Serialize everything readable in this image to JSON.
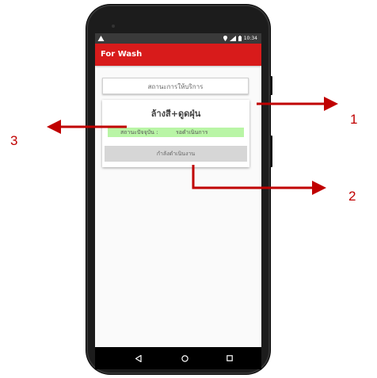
{
  "statusbar": {
    "time": "10:34",
    "icons": [
      "warning-icon",
      "location-icon",
      "signal-icon",
      "battery-icon"
    ]
  },
  "appbar": {
    "title": "For Wash"
  },
  "service_button": {
    "label": "สถานะการให้บริการ"
  },
  "card": {
    "title": "ล้างสี+ดูดฝุ่น",
    "status_label": "สถานะปัจจุบัน :",
    "status_value": "รอดำเนินการ",
    "progress_button": "กำลังดำเนินงาน"
  },
  "navbar": {
    "icons": [
      "back-icon",
      "home-icon",
      "recents-icon"
    ]
  },
  "annotations": {
    "labels": [
      "1",
      "2",
      "3"
    ],
    "color": "#c00000"
  },
  "colors": {
    "appbar": "#d81b1b",
    "status_highlight": "#b9f5a6",
    "progress_button": "#d6d6d6"
  }
}
